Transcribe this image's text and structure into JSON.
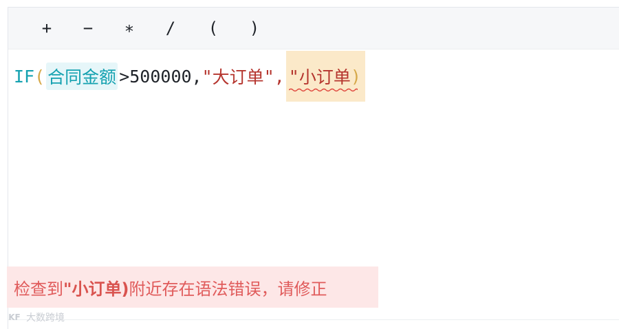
{
  "toolbar": {
    "ops": [
      {
        "label": "+"
      },
      {
        "label": "−"
      },
      {
        "label": "∗"
      },
      {
        "label": "/"
      },
      {
        "label": "("
      },
      {
        "label": ")"
      }
    ]
  },
  "formula": {
    "function": "IF",
    "open_paren": "(",
    "field": "合同金额",
    "condition": ">500000,",
    "str1_open": "\"",
    "str1": "大订单",
    "str1_close": "\",",
    "str2_open": "\"",
    "str2": "小订单",
    "close_paren": ")"
  },
  "error": {
    "prefix": "检查到",
    "highlight": "\"小订单)",
    "suffix": "附近存在语法错误，请修正"
  },
  "watermark": {
    "logo": "KF",
    "text": "大数跨境"
  },
  "colors": {
    "field": "#14a1b0",
    "string": "#b5352e",
    "error_text": "#e05b5b",
    "error_bg": "#fde7e7",
    "error_highlight": "#fbe9c9"
  }
}
